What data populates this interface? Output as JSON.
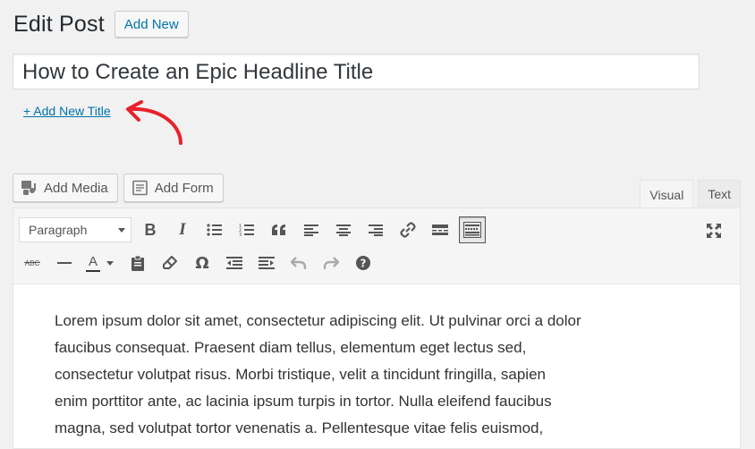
{
  "header": {
    "title": "Edit Post",
    "add_new_label": "Add New"
  },
  "post": {
    "title_value": "How to Create an Epic Headline Title",
    "add_title_link": "+ Add New Title"
  },
  "media_buttons": {
    "add_media": "Add Media",
    "add_form": "Add Form"
  },
  "tabs": [
    {
      "label": "Visual",
      "active": true
    },
    {
      "label": "Text",
      "active": false
    }
  ],
  "toolbar": {
    "format_selected": "Paragraph",
    "row1_icons": [
      "bold-icon",
      "italic-icon",
      "bullet-list-icon",
      "numbered-list-icon",
      "blockquote-icon",
      "align-left-icon",
      "align-center-icon",
      "align-right-icon",
      "insert-link-icon",
      "read-more-icon",
      "toolbar-toggle-icon"
    ],
    "row2_icons": [
      "strikethrough-icon",
      "horizontal-line-icon",
      "text-color-icon",
      "paste-text-icon",
      "clear-formatting-icon",
      "special-character-icon",
      "outdent-icon",
      "indent-icon",
      "undo-icon",
      "redo-icon",
      "help-icon"
    ],
    "bold_label": "B",
    "italic_label": "I",
    "strike_label": "ABC",
    "text_color_label": "A",
    "omega_label": "Ω"
  },
  "colors": {
    "accent": "#0073aa",
    "annotation_arrow": "#e8212a"
  },
  "content": {
    "lines": [
      "Lorem ipsum dolor sit amet, consectetur adipiscing elit. Ut pulvinar orci a dolor",
      "faucibus consequat. Praesent diam tellus, elementum eget lectus sed,",
      "consectetur volutpat risus. Morbi tristique, velit a tincidunt fringilla, sapien",
      "enim porttitor ante, ac lacinia ipsum turpis in tortor. Nulla eleifend faucibus",
      "magna, sed volutpat tortor venenatis a. Pellentesque vitae felis euismod,"
    ]
  }
}
